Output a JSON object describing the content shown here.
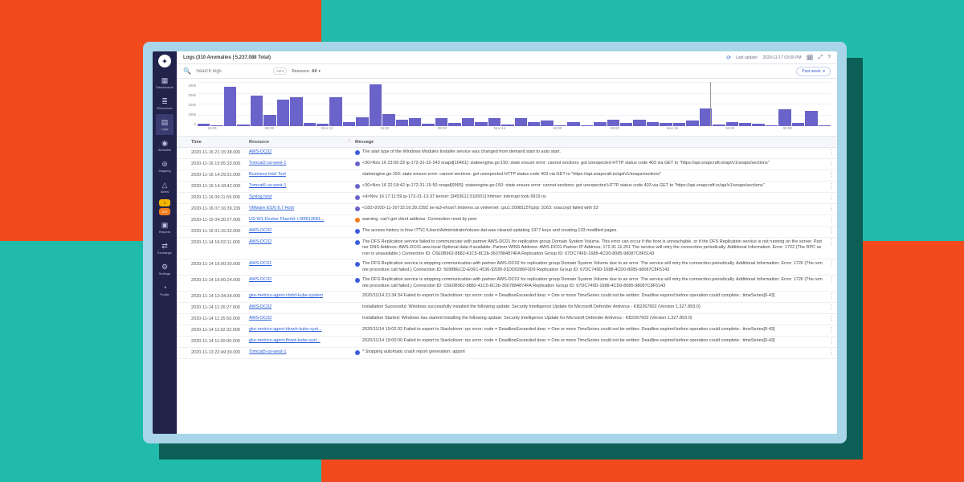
{
  "header": {
    "title": "Logs (310 Anomalies | 5,237,088 Total)",
    "last_update_label": "Last update:",
    "last_update_value": "2020-11-17 03:09 PM"
  },
  "search": {
    "placeholder": "Search logs",
    "pill": "ADV",
    "resource_label": "Resource:",
    "resource_value": "All",
    "range_label": "Past week"
  },
  "sidebar": {
    "items": [
      {
        "icon": "▦",
        "label": "Dashboards"
      },
      {
        "icon": "≣",
        "label": "Resources"
      },
      {
        "icon": "▤",
        "label": "Logs",
        "active": true
      },
      {
        "icon": "◉",
        "label": "Websites"
      },
      {
        "icon": "⊚",
        "label": "Mapping"
      },
      {
        "icon": "△",
        "label": "Alerts"
      },
      {
        "icon": "▣",
        "label": "Reports"
      },
      {
        "icon": "⇄",
        "label": "Exchange"
      },
      {
        "icon": "⚙",
        "label": "Settings"
      },
      {
        "icon": "◔",
        "label": "Profile"
      }
    ],
    "badges": [
      "2",
      "679"
    ]
  },
  "chart_data": {
    "type": "bar",
    "title": "",
    "xlabel": "",
    "ylabel": "",
    "ylim": [
      0,
      400000
    ],
    "yticks": [
      "400k",
      "300k",
      "200k",
      "100k",
      "0"
    ],
    "categories": [
      "16:00",
      "",
      "08:00",
      "",
      "Nov 12",
      "",
      "16:00",
      "",
      "08:00",
      "",
      "Nov 14",
      "",
      "16:00",
      "",
      "08:00",
      "",
      "Nov 16",
      "",
      "16:00",
      "",
      "08:00",
      ""
    ],
    "values": [
      20000,
      10000,
      360000,
      15000,
      280000,
      100000,
      240000,
      260000,
      30000,
      20000,
      260000,
      40000,
      80000,
      380000,
      110000,
      60000,
      70000,
      20000,
      70000,
      30000,
      70000,
      40000,
      70000,
      15000,
      70000,
      40000,
      50000,
      10000,
      40000,
      10000,
      40000,
      60000,
      30000,
      60000,
      40000,
      30000,
      30000,
      50000,
      160000,
      15000,
      40000,
      30000,
      25000,
      10000,
      150000,
      30000,
      140000,
      10000
    ],
    "marker_x_pct": 81
  },
  "table": {
    "columns": {
      "time": "Time",
      "resource": "Resource",
      "message": "Message"
    },
    "rows": [
      {
        "time": "2020-11-16 21:15:38.000",
        "resource": "AWS-DC02",
        "dot": "blue",
        "message": "The start type of the Windows Modules Installer service was changed from demand start to auto start."
      },
      {
        "time": "2020-11-16 15:05:33.000",
        "resource": "Tomcat2-us-west-1",
        "dot": "purple",
        "message": "<30>Nov 16 23:05:33 ip-172-31-22-243 snapd[10461]: stateengine.go:150: state ensure error: cannot sections: got unexpected HTTP status code 403 via GET to \"https://api.snapcraft.io/api/v1/snaps/sections\""
      },
      {
        "time": "2020-11-16 14:29:31.000",
        "resource": "Business Intel Tool",
        "dot": "",
        "message": "stateengine.go:150: state ensure error: cannot sections: got unexpected HTTP status code 403 via GET to \"https://api.snapcraft.io/api/v1/snaps/sections\""
      },
      {
        "time": "2020-11-16 14:18:42.000",
        "resource": "Tomcat6-us-west-1",
        "dot": "purple",
        "message": "<30>Nov 16 22:18:42 ip-172-31-15-50 snapd[9965]: stateengine.go:150: state ensure error: cannot sections: got unexpected HTTP status code 403 via GET to \"https://api.snapcraft.io/api/v1/snaps/sections\""
      },
      {
        "time": "2020-11-16 09:11:59.000",
        "resource": "Syslog host",
        "dot": "purple",
        "message": "<4>Nov 16 17:11:59 ip-172-31-13-37 kernel: [3453612.516501] hrtimer: interrupt took 9919 ns"
      },
      {
        "time": "2020-11-16 07:16:39.239",
        "resource": "VMware ESXi 6.7 Host",
        "dot": "purple",
        "message": "<182>2020-11-16T15:16:39.239Z se-la3-ehost7.lmdemo.us vmkernel: cpu1:2098115Tcpip: 3163: soaccept failed with 53"
      },
      {
        "time": "2020-11-15 04:30:27.000",
        "resource": "US-W1-Docker Fluentd: i-00f913681...",
        "dot": "orange",
        "message": "warning: can't get client address: Connection reset by peer"
      },
      {
        "time": "2020-11-15 01:15:32.000",
        "resource": "AWS-DC02",
        "dot": "blue",
        "message": "The access history in hive \\??\\C:\\Users\\Administrator\\ntuser.dat was cleared updating 1977 keys and creating 133 modified pages."
      },
      {
        "time": "2020-11-14 16:02:11.000",
        "resource": "AWS-DC02",
        "dot": "blue",
        "message": "The DFS Replication service failed to communicate with partner AWS-DC01 for replication group Domain System Volume. This error can occur if the host is unreachable, or if the DFS Replication service is not running on the server. Partner DNS Address: AWS-DC01.aws.local Optional data if available: Partner WINS Address: AWS-DC01 Partner IP Address: 172.31.11.251 The service will retry the connection periodically. Additional Information: Error: 1722 (The RPC server is unavailable.) Connection ID: C6E0B962-8882-41C5-8C2b-3607884874FA Replication Group ID: 67DC749D-1688-4CD0-8085-98087C8F5143"
      },
      {
        "time": "2020-11-14 16:00:30.000",
        "resource": "AWS-DC01",
        "dot": "blue",
        "message": "The DFS Replication service is stopping communication with partner AWS-DC02 for replication group Domain System Volume due to an error. The service will retry the connection periodically. Additional Information: Error: 1726 (The remote procedure call failed.) Connection ID: 5098BECD-E06C-4536-92DB-91DD0286F0D9 Replication Group ID: 67DC749D-1688-4CD0-8085-98087C8F5143"
      },
      {
        "time": "2020-11-14 16:00:24.000",
        "resource": "AWS-DC02",
        "dot": "blue",
        "message": "The DFS Replication service is stopping communication with partner AWS-DC01 for replication group Domain System Volume due to an error. The service will retry the connection periodically. Additional Information: Error: 1726 (The remote procedure call failed.) Connection ID: C6E0B962-8882-41C5-8C2b-3607884874FA Replication Group ID: 67DC749D-1688-4CD0-8085-98087C8F5143"
      },
      {
        "time": "2020-11-14 13:34:34.000",
        "resource": "gke-metrics-agent-cbdxf-kube-system",
        "dot": "",
        "message": "2020/11/14 21:34:34 Failed to export to Stackdriver: rpc error: code = DeadlineExceeded desc = One or more TimeSeries could not be written: Deadline expired before operation could complete.: timeSeries[0-43]"
      },
      {
        "time": "2020-11-14 11:26:27.000",
        "resource": "AWS-DC02",
        "dot": "",
        "message": "Installation Successful: Windows successfully installed the following update: Security Intelligence Update for Microsoft Defender Antivirus - KB2267602 (Version 1.327.893.0)"
      },
      {
        "time": "2020-11-14 11:25:56.000",
        "resource": "AWS-DC02",
        "dot": "",
        "message": "Installation Started: Windows has started installing the following update: Security Intelligence Update for Microsoft Defender Antivirus - KB2267602 (Version 1.327.893.0)"
      },
      {
        "time": "2020-11-14 11:02:32.000",
        "resource": "gke-metrics-agent-hkrwh-kube-syst...",
        "dot": "",
        "message": "2020/11/14 19:02:32 Failed to export to Stackdriver: rpc error: code = DeadlineExceeded desc = One or more TimeSeries could not be written: Deadline expired before operation could complete.: timeSeries[0-43]"
      },
      {
        "time": "2020-11-14 11:00:00.000",
        "resource": "gke-metrics-agent-fhvwt-kube-syst...",
        "dot": "",
        "message": "2020/11/14 19:00:00 Failed to export to Stackdriver: rpc error: code = DeadlineExceeded desc = One or more TimeSeries could not be written: Deadline expired before operation could complete.: timeSeries[0-43]"
      },
      {
        "time": "2020-11-13 22:49:39.000",
        "resource": "Tomcat5-us-west-1",
        "dot": "blue",
        "message": "* Stopping automatic crash report generation: apport"
      }
    ]
  }
}
